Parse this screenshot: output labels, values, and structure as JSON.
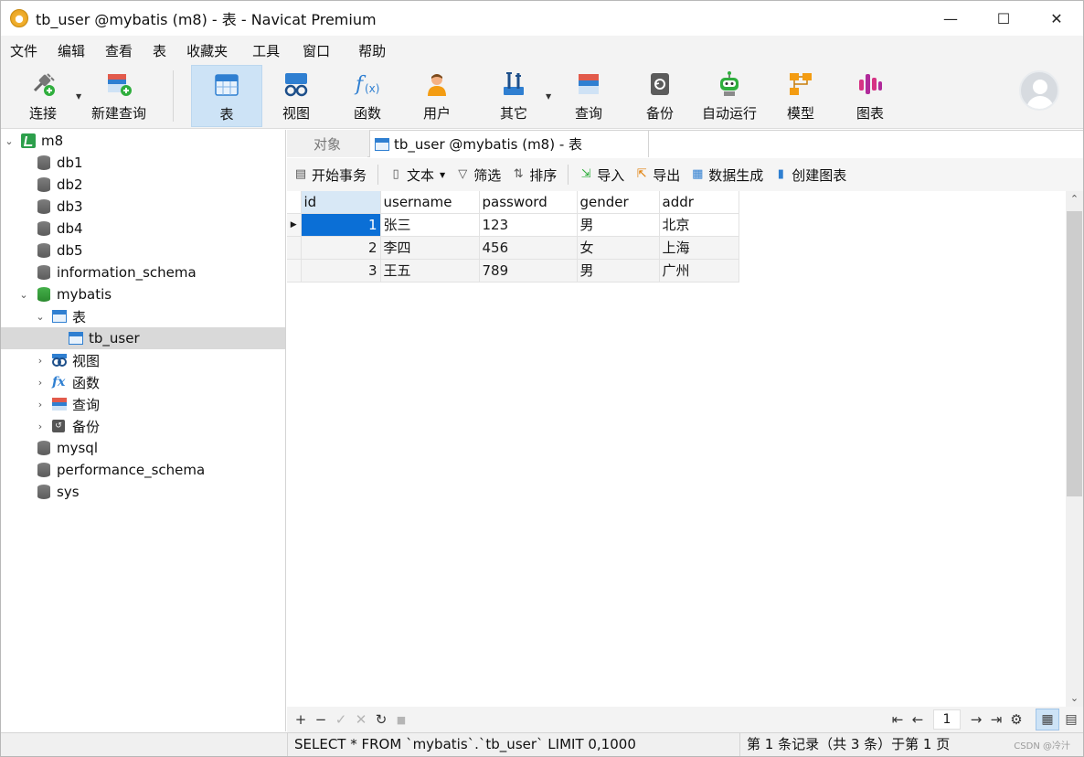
{
  "window": {
    "title": "tb_user @mybatis (m8) - 表 - Navicat Premium",
    "minimize": "—",
    "maximize": "☐",
    "close": "✕"
  },
  "menu": [
    "文件",
    "编辑",
    "查看",
    "表",
    "收藏夹",
    "工具",
    "窗口",
    "帮助"
  ],
  "toolbar": {
    "connect": "连接",
    "new_query": "新建查询",
    "table": "表",
    "view": "视图",
    "function": "函数",
    "user": "用户",
    "other": "其它",
    "query": "查询",
    "backup": "备份",
    "automation": "自动运行",
    "model": "模型",
    "chart": "图表"
  },
  "tree": {
    "connection": "m8",
    "databases": [
      "db1",
      "db2",
      "db3",
      "db4",
      "db5",
      "information_schema"
    ],
    "open_db": "mybatis",
    "table_group": "表",
    "table": "tb_user",
    "view_group": "视图",
    "function_group": "函数",
    "query_group": "查询",
    "backup_group": "备份",
    "other_dbs": [
      "mysql",
      "performance_schema",
      "sys"
    ]
  },
  "tabs": {
    "objects": "对象",
    "active": "tb_user @mybatis (m8) - 表"
  },
  "subtoolbar": {
    "begin_transaction": "开始事务",
    "text": "文本",
    "filter": "筛选",
    "sort": "排序",
    "import": "导入",
    "export": "导出",
    "data_generation": "数据生成",
    "create_chart": "创建图表"
  },
  "grid": {
    "columns": [
      "id",
      "username",
      "password",
      "gender",
      "addr"
    ],
    "rows": [
      [
        "1",
        "张三",
        "123",
        "男",
        "北京"
      ],
      [
        "2",
        "李四",
        "456",
        "女",
        "上海"
      ],
      [
        "3",
        "王五",
        "789",
        "男",
        "广州"
      ]
    ]
  },
  "nav": {
    "add": "+",
    "delete": "−",
    "apply": "✓",
    "discard": "✕",
    "refresh": "↻",
    "stop": "■",
    "page": "1"
  },
  "status": {
    "sql": "SELECT * FROM `mybatis`.`tb_user` LIMIT 0,1000",
    "record": "第 1 条记录（共 3 条）于第 1 页",
    "watermark": "CSDN @冷汁"
  }
}
